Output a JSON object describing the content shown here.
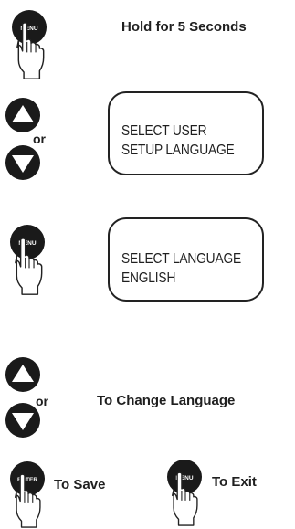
{
  "steps": [
    {
      "instruction": "Hold for 5 Seconds",
      "button": "MENU"
    },
    {
      "connector": "or",
      "display": {
        "line1": "SELECT USER",
        "line2": "SETUP LANGUAGE"
      }
    },
    {
      "button": "MENU",
      "display": {
        "line1": "SELECT LANGUAGE",
        "line2": "ENGLISH"
      }
    },
    {
      "connector": "or",
      "instruction": "To Change Language"
    },
    {
      "save": {
        "button": "ENTER",
        "label": "To Save"
      },
      "exit": {
        "button": "MENU",
        "label": "To Exit"
      }
    }
  ],
  "colors": {
    "button_fill": "#1a1a1a",
    "button_text": "#ffffff",
    "line": "#222222"
  },
  "icons": [
    "menu-button-icon",
    "up-arrow-button-icon",
    "down-arrow-button-icon",
    "enter-button-icon",
    "pointing-hand-icon"
  ]
}
